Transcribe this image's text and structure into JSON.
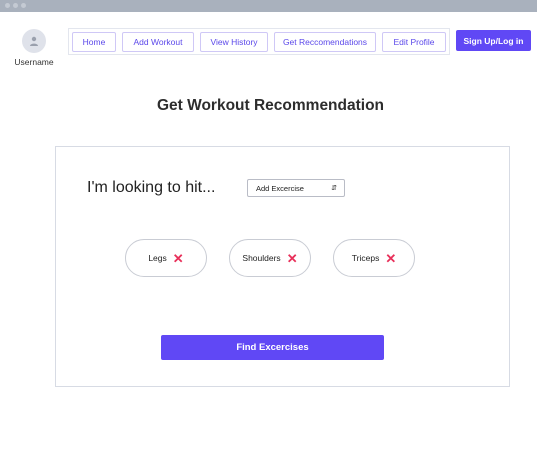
{
  "user": {
    "name": "Username"
  },
  "nav": {
    "items": [
      "Home",
      "Add Workout",
      "View History",
      "Get Reccomendations",
      "Edit Profile"
    ]
  },
  "auth": {
    "signup_label": "Sign Up/Log in"
  },
  "page": {
    "title": "Get Workout Recommendation"
  },
  "form": {
    "prompt": "I'm looking to hit...",
    "select_value": "Add Excercise",
    "chips": [
      {
        "label": "Legs"
      },
      {
        "label": "Shoulders"
      },
      {
        "label": "Triceps"
      }
    ],
    "submit_label": "Find Excercises"
  },
  "colors": {
    "accent": "#6048f5",
    "remove": "#e8305a"
  }
}
